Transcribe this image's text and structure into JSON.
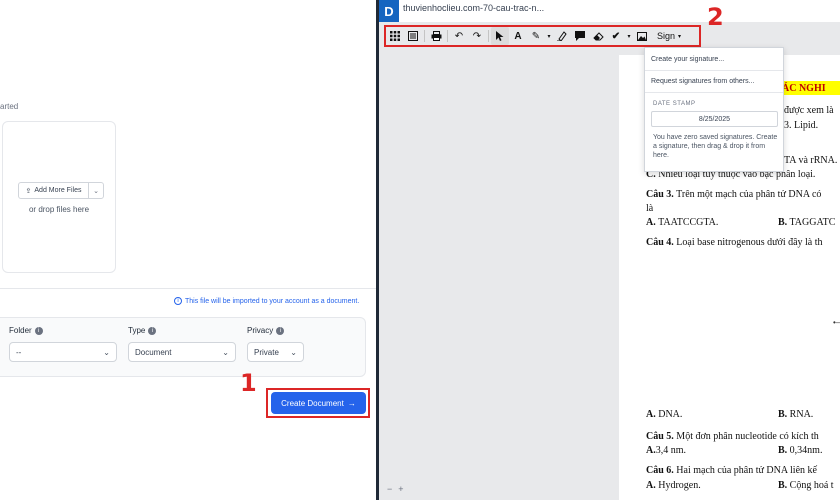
{
  "left_panel": {
    "started_text": "arted",
    "dropzone": {
      "add_more_label": "Add More Files",
      "or_drop_text": "or drop files here"
    },
    "import_note": "This file will be imported to your account as a document.",
    "folder": {
      "label": "Folder",
      "value": "--"
    },
    "type": {
      "label": "Type",
      "value": "Document"
    },
    "privacy": {
      "label": "Privacy",
      "value": "Private"
    },
    "create_button_label": "Create Document",
    "callout_number": "1"
  },
  "right_panel": {
    "title": "thuvienhoclieu.com-70-cau-trac-n...",
    "callout_number": "2",
    "toolbar": {
      "icons": [
        "grid-icon",
        "panel-icon",
        "print-icon",
        "undo-icon",
        "redo-icon",
        "cursor-icon",
        "text-icon",
        "pen-icon",
        "highlighter-icon",
        "comment-icon",
        "eraser-icon",
        "check-icon",
        "image-icon"
      ],
      "sign_label": "Sign"
    },
    "sign_menu": {
      "create_label": "Create your signature...",
      "request_label": "Request signatures from others...",
      "date_stamp_label": "DATE STAMP",
      "date_value": "8/25/2025",
      "note": "You have zero saved signatures. Create a signature, then drag & drop it from here."
    },
    "document": {
      "heading_fragment": "ÁC NGHI",
      "lines": {
        "l1": "được xem là",
        "l2": "3. Lipid.",
        "l3": "TA và rRNA.",
        "l4": "Nhiều loại tùy thuộc vào bậc phân loại.",
        "l5": "Trên một mạch của phân tử DNA có",
        "l6": "là",
        "l7": "TAATCCGTA.",
        "l8": "TAGGATC",
        "l9": "Loại base nitrogenous dưới đây là th",
        "l10": "DNA.",
        "l11": "RNA.",
        "l12": "Một đơn phân nucleotide có kích th",
        "l13": "3,4 nm.",
        "l14": "0,34nm.",
        "l15": "Hai mạch của phân tử DNA liên kế",
        "l16": "Hydrogen.",
        "l17": "Cộng hoá t"
      },
      "labels": {
        "C": "C.",
        "A": "A.",
        "B": "B.",
        "cau3": "Câu 3.",
        "cau4": "Câu 4.",
        "cau5": "Câu 5.",
        "cau6": "Câu 6."
      }
    },
    "zoom_minus": "−",
    "zoom_plus": "+"
  },
  "colors": {
    "accent": "#2563eb",
    "callout": "#dc2626",
    "logo": "#1565c0",
    "highlight": "#ffff00"
  }
}
